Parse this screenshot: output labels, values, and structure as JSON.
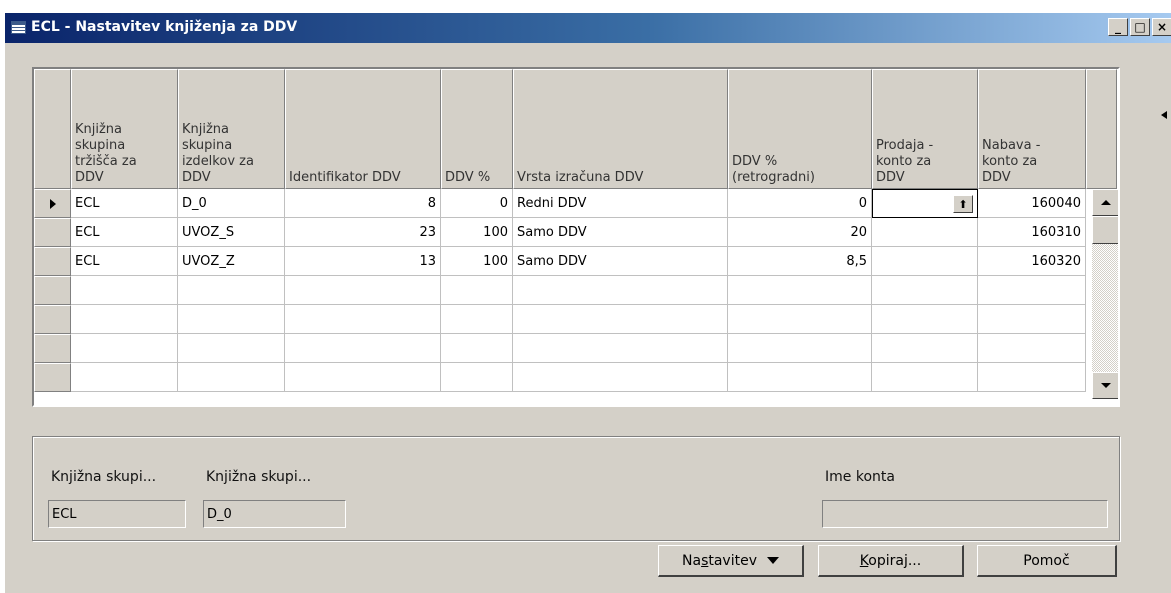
{
  "window": {
    "title": "ECL - Nastavitev knjiženja za DDV",
    "minimize_icon": "_",
    "maximize_icon": "□",
    "close_icon": "×"
  },
  "grid": {
    "columns": [
      "Knjižna\nskupina\ntržišča za\nDDV",
      "Knjižna\nskupina\nizdelkov za\nDDV",
      "Identifikator DDV",
      "DDV %",
      "Vrsta izračuna DDV",
      "DDV %\n(retrogradni)",
      "Prodaja -\nkonto za\nDDV",
      "Nabava -\nkonto za\nDDV"
    ],
    "rows": [
      {
        "market_group": "ECL",
        "product_group": "D_0",
        "vat_id": "8",
        "vat_pct": "0",
        "calc_type": "Redni DDV",
        "vat_pct_retro": "0",
        "sales_account": "",
        "purchase_account": "160040"
      },
      {
        "market_group": "ECL",
        "product_group": "UVOZ_S",
        "vat_id": "23",
        "vat_pct": "100",
        "calc_type": "Samo DDV",
        "vat_pct_retro": "20",
        "sales_account": "",
        "purchase_account": "160310"
      },
      {
        "market_group": "ECL",
        "product_group": "UVOZ_Z",
        "vat_id": "13",
        "vat_pct": "100",
        "calc_type": "Samo DDV",
        "vat_pct_retro": "8,5",
        "sales_account": "",
        "purchase_account": "160320"
      }
    ],
    "lookup_icon": "⬆"
  },
  "details": {
    "label1": "Knjižna skupi...",
    "value1": "ECL",
    "label2": "Knjižna skupi...",
    "value2": "D_0",
    "label3": "Ime konta",
    "value3": ""
  },
  "buttons": {
    "setup_pre": "Na",
    "setup_ul": "s",
    "setup_post": "tavitev",
    "copy_ul": "K",
    "copy_post": "opiraj...",
    "help": "Pomoč"
  }
}
